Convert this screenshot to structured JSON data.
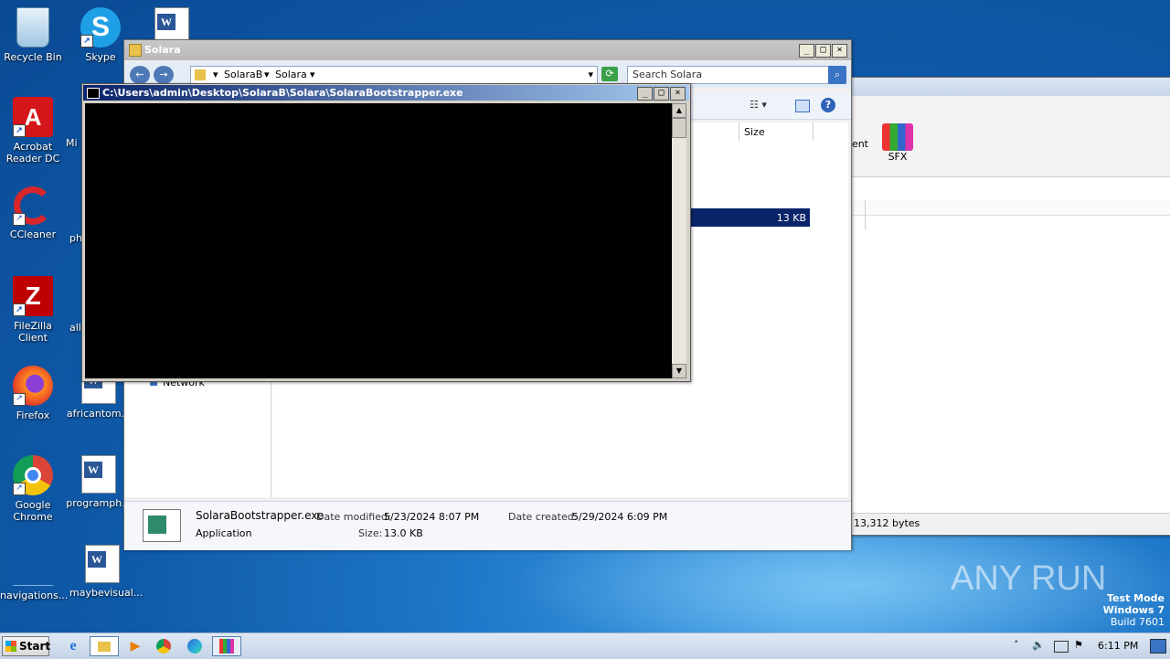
{
  "desktop": {
    "icons": [
      {
        "label": "Recycle Bin",
        "icon": "recycle-bin-icon"
      },
      {
        "label": "Skype",
        "icon": "skype-icon"
      },
      {
        "label": "Acrobat Reader DC",
        "icon": "acrobat-icon"
      },
      {
        "label": "Mi",
        "icon": "word-doc-icon"
      },
      {
        "label": "CCleaner",
        "icon": "ccleaner-icon"
      },
      {
        "label": "ph",
        "icon": "word-doc-icon"
      },
      {
        "label": "FileZilla Client",
        "icon": "filezilla-icon"
      },
      {
        "label": "all",
        "icon": "word-doc-icon"
      },
      {
        "label": "Firefox",
        "icon": "firefox-icon"
      },
      {
        "label": "africantom...",
        "icon": "word-doc-icon"
      },
      {
        "label": "Google Chrome",
        "icon": "chrome-icon"
      },
      {
        "label": "programph...",
        "icon": "word-doc-icon"
      },
      {
        "label": "navigations...",
        "icon": "blank-file-icon"
      },
      {
        "label": "maybevisual...",
        "icon": "word-doc-icon"
      }
    ],
    "watermark": {
      "brand": "ANY RUN",
      "line1": "Test Mode",
      "line2": "Windows 7",
      "line3": "Build 7601"
    }
  },
  "explorer": {
    "title": "Solara",
    "breadcrumb": [
      "SolaraB",
      "Solara"
    ],
    "search_placeholder": "Search Solara",
    "column_size": "Size",
    "selected_size": "13 KB",
    "nav_partial": "Network",
    "details": {
      "name": "SolaraBootstrapper.exe",
      "type": "Application",
      "modified_label": "Date modified:",
      "modified_value": "5/23/2024 8:07 PM",
      "size_label": "Size:",
      "size_value": "13.0 KB",
      "created_label": "Date created:",
      "created_value": "5/29/2024 6:09 PM"
    }
  },
  "bgwindow": {
    "item_label_partial": "ent",
    "sfx_label": "SFX",
    "status": "13,312 bytes"
  },
  "console": {
    "title": "C:\\Users\\admin\\Desktop\\SolaraB\\Solara\\SolaraBootstrapper.exe"
  },
  "taskbar": {
    "start_label": "Start",
    "clock": "6:11 PM"
  }
}
